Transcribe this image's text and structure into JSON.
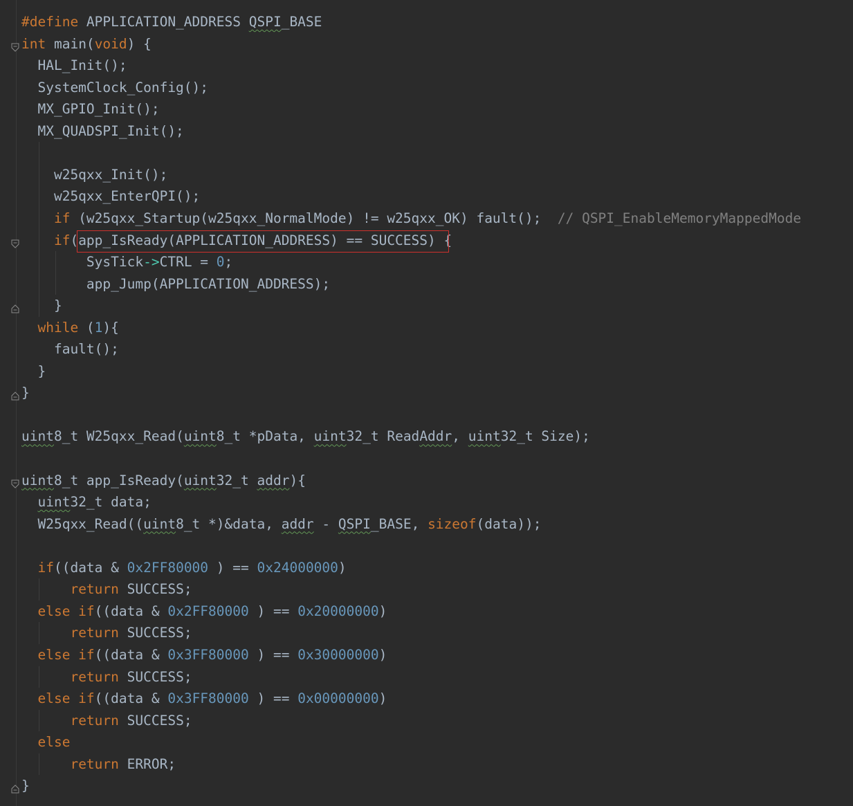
{
  "editor": {
    "colors": {
      "background": "#2b2b2b",
      "text": "#a9b7c6",
      "keyword": "#cc7832",
      "number": "#6897bb",
      "comment": "#808080",
      "highlight_box": "#d0312d"
    },
    "lines": [
      {
        "tokens": [
          {
            "t": "#define ",
            "c": "kw"
          },
          {
            "t": "APPLICATION_ADDRESS "
          },
          {
            "t": "QSPI",
            "c": "sq"
          },
          {
            "t": "_BASE"
          }
        ]
      },
      {
        "tokens": [
          {
            "t": "int",
            "c": "kw"
          },
          {
            "t": " main("
          },
          {
            "t": "void",
            "c": "kw"
          },
          {
            "t": ") {"
          }
        ]
      },
      {
        "tokens": [
          {
            "t": "  HAL_Init();"
          }
        ]
      },
      {
        "tokens": [
          {
            "t": "  SystemClock_Config();"
          }
        ]
      },
      {
        "tokens": [
          {
            "t": "  MX_GPIO_Init();"
          }
        ]
      },
      {
        "tokens": [
          {
            "t": "  MX_QUADSPI_Init();"
          }
        ]
      },
      {
        "tokens": []
      },
      {
        "tokens": [
          {
            "t": "    w25qxx_Init();"
          }
        ]
      },
      {
        "tokens": [
          {
            "t": "    w25qxx_EnterQPI();"
          }
        ]
      },
      {
        "tokens": [
          {
            "t": "    "
          },
          {
            "t": "if",
            "c": "kw"
          },
          {
            "t": " (w25qxx_Startup(w25qxx_NormalMode) != w25qxx_OK) fault();  "
          },
          {
            "t": "// QSPI_EnableMemoryMappedMode",
            "c": "cm"
          }
        ]
      },
      {
        "tokens": [
          {
            "t": "    "
          },
          {
            "t": "if",
            "c": "kw"
          },
          {
            "t": "(app_IsReady(APPLICATION_ADDRESS) == SUCCESS) {"
          }
        ]
      },
      {
        "tokens": [
          {
            "t": "        SysTick"
          },
          {
            "t": "->",
            "c": "arrow"
          },
          {
            "t": "CTRL = "
          },
          {
            "t": "0",
            "c": "num"
          },
          {
            "t": ";"
          }
        ]
      },
      {
        "tokens": [
          {
            "t": "        app_Jump(APPLICATION_ADDRESS);"
          }
        ]
      },
      {
        "tokens": [
          {
            "t": "    }"
          }
        ]
      },
      {
        "tokens": [
          {
            "t": "  "
          },
          {
            "t": "while",
            "c": "kw"
          },
          {
            "t": " ("
          },
          {
            "t": "1",
            "c": "num"
          },
          {
            "t": "){"
          }
        ]
      },
      {
        "tokens": [
          {
            "t": "    fault();"
          }
        ]
      },
      {
        "tokens": [
          {
            "t": "  }"
          }
        ]
      },
      {
        "tokens": [
          {
            "t": "}"
          }
        ]
      },
      {
        "tokens": []
      },
      {
        "tokens": [
          {
            "t": "uint",
            "c": "sq"
          },
          {
            "t": "8_t W25qxx_Read("
          },
          {
            "t": "uint",
            "c": "sq"
          },
          {
            "t": "8_t *pData, "
          },
          {
            "t": "uint",
            "c": "sq"
          },
          {
            "t": "32_t Read"
          },
          {
            "t": "Addr",
            "c": "sq"
          },
          {
            "t": ", "
          },
          {
            "t": "uint",
            "c": "sq"
          },
          {
            "t": "32_t Size);"
          }
        ]
      },
      {
        "tokens": []
      },
      {
        "tokens": [
          {
            "t": "uint",
            "c": "sq"
          },
          {
            "t": "8_t app_IsReady("
          },
          {
            "t": "uint",
            "c": "sq"
          },
          {
            "t": "32_t "
          },
          {
            "t": "addr",
            "c": "sq"
          },
          {
            "t": "){"
          }
        ]
      },
      {
        "tokens": [
          {
            "t": "  "
          },
          {
            "t": "uint",
            "c": "sq"
          },
          {
            "t": "32_t data;"
          }
        ]
      },
      {
        "tokens": [
          {
            "t": "  W25qxx_Read(("
          },
          {
            "t": "uint",
            "c": "sq"
          },
          {
            "t": "8_t *)&data, "
          },
          {
            "t": "addr",
            "c": "sq"
          },
          {
            "t": " - "
          },
          {
            "t": "QSPI",
            "c": "sq"
          },
          {
            "t": "_BASE, "
          },
          {
            "t": "sizeof",
            "c": "kw"
          },
          {
            "t": "(data));"
          }
        ]
      },
      {
        "tokens": []
      },
      {
        "tokens": [
          {
            "t": "  "
          },
          {
            "t": "if",
            "c": "kw"
          },
          {
            "t": "((data & "
          },
          {
            "t": "0x2FF80000",
            "c": "num"
          },
          {
            "t": " ) == "
          },
          {
            "t": "0x24000000",
            "c": "num"
          },
          {
            "t": ")"
          }
        ]
      },
      {
        "tokens": [
          {
            "t": "      "
          },
          {
            "t": "return",
            "c": "kw"
          },
          {
            "t": " SUCCESS;"
          }
        ]
      },
      {
        "tokens": [
          {
            "t": "  "
          },
          {
            "t": "else if",
            "c": "kw"
          },
          {
            "t": "((data & "
          },
          {
            "t": "0x2FF80000",
            "c": "num"
          },
          {
            "t": " ) == "
          },
          {
            "t": "0x20000000",
            "c": "num"
          },
          {
            "t": ")"
          }
        ]
      },
      {
        "tokens": [
          {
            "t": "      "
          },
          {
            "t": "return",
            "c": "kw"
          },
          {
            "t": " SUCCESS;"
          }
        ]
      },
      {
        "tokens": [
          {
            "t": "  "
          },
          {
            "t": "else if",
            "c": "kw"
          },
          {
            "t": "((data & "
          },
          {
            "t": "0x3FF80000",
            "c": "num"
          },
          {
            "t": " ) == "
          },
          {
            "t": "0x30000000",
            "c": "num"
          },
          {
            "t": ")"
          }
        ]
      },
      {
        "tokens": [
          {
            "t": "      "
          },
          {
            "t": "return",
            "c": "kw"
          },
          {
            "t": " SUCCESS;"
          }
        ]
      },
      {
        "tokens": [
          {
            "t": "  "
          },
          {
            "t": "else if",
            "c": "kw"
          },
          {
            "t": "((data & "
          },
          {
            "t": "0x3FF80000",
            "c": "num"
          },
          {
            "t": " ) == "
          },
          {
            "t": "0x00000000",
            "c": "num"
          },
          {
            "t": ")"
          }
        ]
      },
      {
        "tokens": [
          {
            "t": "      "
          },
          {
            "t": "return",
            "c": "kw"
          },
          {
            "t": " SUCCESS;"
          }
        ]
      },
      {
        "tokens": [
          {
            "t": "  "
          },
          {
            "t": "else",
            "c": "kw"
          }
        ]
      },
      {
        "tokens": [
          {
            "t": "      "
          },
          {
            "t": "return",
            "c": "kw"
          },
          {
            "t": " ERROR;"
          }
        ]
      },
      {
        "tokens": [
          {
            "t": "}"
          }
        ]
      }
    ],
    "fold_markers": [
      {
        "line": 1,
        "icon": "fold-open-icon"
      },
      {
        "line": 10,
        "icon": "fold-open-icon"
      },
      {
        "line": 13,
        "icon": "fold-close-icon"
      },
      {
        "line": 17,
        "icon": "fold-close-icon"
      },
      {
        "line": 21,
        "icon": "fold-open-icon"
      },
      {
        "line": 35,
        "icon": "fold-close-icon"
      }
    ],
    "highlighted_text": "app_IsReady(APPLICATION_ADDRESS) == SUCCESS)"
  }
}
